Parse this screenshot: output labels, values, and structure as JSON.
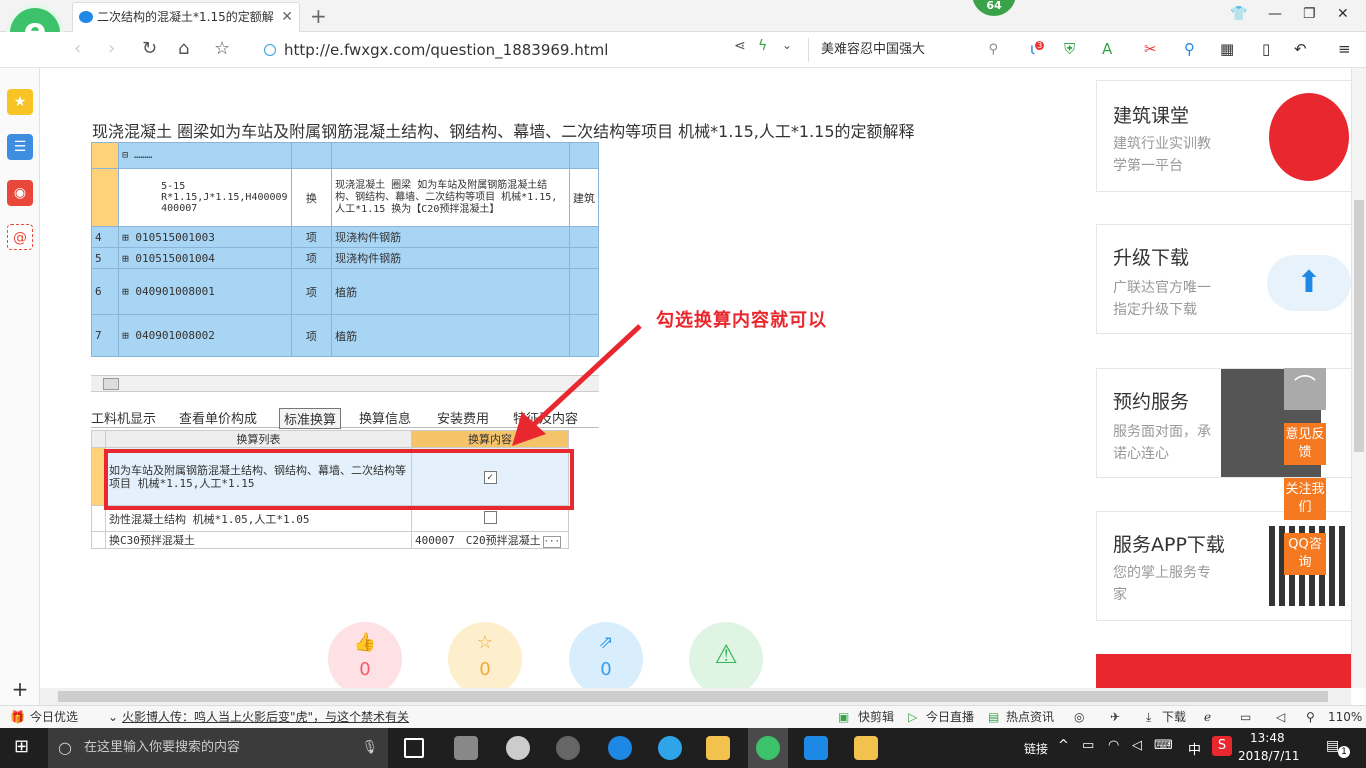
{
  "browser": {
    "tab_title": "二次结构的混凝土*1.15的定额解",
    "badge": "64",
    "url": "http://e.fwxgx.com/question_1883969.html",
    "search_text": "美难容忍中国强大",
    "ext_badge": "3"
  },
  "page": {
    "heading": "现浇混凝土 圈梁如为车站及附属钢筋混凝土结构、钢结构、幕墙、二次结构等项目 机械*1.15,人工*1.15的定额解释",
    "annotation": "勾选换算内容就可以",
    "screenshot": {
      "sub_row_code": "5-15 R*1.15,J*1.15,H400009 400007",
      "sub_row_type": "换",
      "sub_row_desc": "现浇混凝土 圈梁 如为车站及附属钢筋混凝土结构、钢结构、幕墙、二次结构等项目 机械*1.15,人工*1.15 换为【C20预拌混凝土】",
      "sub_row_extra": "建筑",
      "rows": [
        {
          "no": "4",
          "code": "010515001003",
          "type": "项",
          "name": "现浇构件钢筋"
        },
        {
          "no": "5",
          "code": "010515001004",
          "type": "项",
          "name": "现浇构件钢筋"
        },
        {
          "no": "6",
          "code": "040901008001",
          "type": "项",
          "name": "植筋"
        },
        {
          "no": "7",
          "code": "040901008002",
          "type": "项",
          "name": "植筋"
        }
      ],
      "tabs": [
        "工料机显示",
        "查看单价构成",
        "标准换算",
        "换算信息",
        "安装费用",
        "特征及内容"
      ],
      "col_list": "换算列表",
      "col_content": "换算内容",
      "lower_rows": [
        {
          "text": "如为车站及附属钢筋混凝土结构、钢结构、幕墙、二次结构等项目 机械*1.15,人工*1.15",
          "checked": true
        },
        {
          "text": "劲性混凝土结构 机械*1.05,人工*1.05",
          "checked": false
        },
        {
          "text": "换C30预拌混凝土",
          "value": "400007　C20预拌混凝土"
        }
      ]
    },
    "reactions": [
      {
        "icon": "thumbs-up-icon",
        "count": "0"
      },
      {
        "icon": "star-icon",
        "count": "0"
      },
      {
        "icon": "share-icon",
        "count": "0"
      },
      {
        "icon": "warning-icon",
        "count": ""
      }
    ]
  },
  "sidebar_ads": [
    {
      "title": "建筑课堂",
      "line1": "建筑行业实训教",
      "line2": "学第一平台"
    },
    {
      "title": "升级下载",
      "line1": "广联达官方唯一",
      "line2": "指定升级下载"
    },
    {
      "title": "预约服务",
      "line1": "服务面对面，承",
      "line2": "诺心连心"
    },
    {
      "title": "服务APP下载",
      "line1": "您的掌上服务专",
      "line2": "家"
    }
  ],
  "float_buttons": [
    "意见反馈",
    "关注我们",
    "QQ咨询"
  ],
  "status_bar": {
    "left": "今日优选",
    "news": "火影博人传：鸣人当上火影后变\"虎\"，与这个禁术有关",
    "items": [
      "快剪辑",
      "今日直播",
      "热点资讯",
      "下载"
    ],
    "zoom": "110%"
  },
  "taskbar": {
    "search_placeholder": "在这里输入你要搜索的内容",
    "tray": [
      "链接",
      "中"
    ],
    "time": "13:48",
    "date": "2018/7/11",
    "notify": "1"
  }
}
